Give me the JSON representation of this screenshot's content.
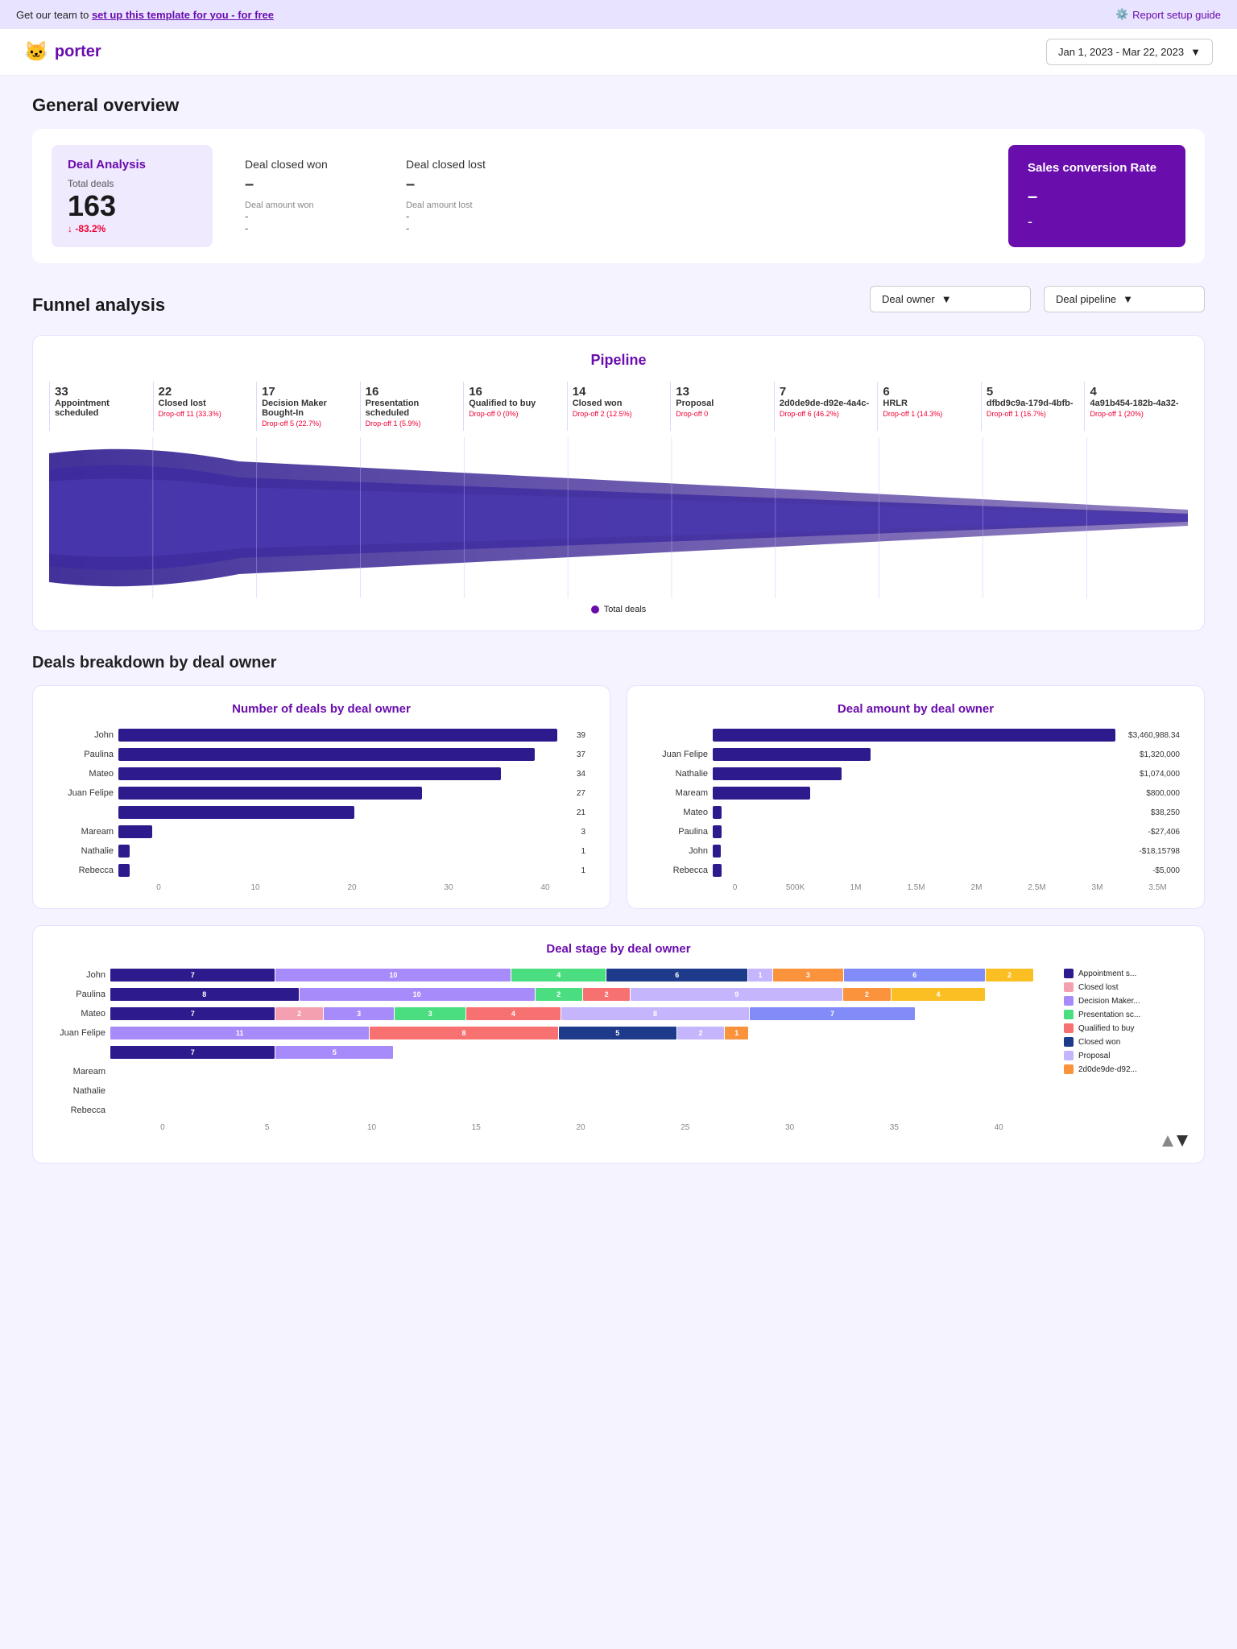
{
  "banner": {
    "text_prefix": "Get our team to ",
    "link_text": "set up this template for you - for free",
    "report_link": "Report setup guide"
  },
  "header": {
    "logo_text": "porter",
    "date_range": "Jan 1, 2023 - Mar 22, 2023"
  },
  "overview": {
    "section_title": "General overview",
    "deal_analysis": {
      "title": "Deal Analysis",
      "total_label": "Total deals",
      "total_value": "163",
      "change": "↓ -83.2%"
    },
    "deal_closed_won": {
      "title": "Deal closed won",
      "value": "–",
      "sub_label": "Deal amount won",
      "sub_value": "-"
    },
    "deal_closed_lost": {
      "title": "Deal closed lost",
      "value": "–",
      "sub_label": "Deal amount lost",
      "sub_value": "-"
    },
    "sales_conversion": {
      "title": "Sales conversion Rate",
      "value": "–",
      "sub_value": "-"
    }
  },
  "funnel": {
    "section_title": "Funnel analysis",
    "dropdown1": "Deal owner",
    "dropdown2": "Deal pipeline",
    "chart_title": "Pipeline",
    "legend": "Total deals",
    "stages": [
      {
        "num": "33",
        "name": "Appointment scheduled",
        "drop": ""
      },
      {
        "num": "22",
        "name": "Closed lost",
        "drop": "Drop-off 11 (33.3%)"
      },
      {
        "num": "17",
        "name": "Decision Maker Bought-In",
        "drop": "Drop-off 5 (22.7%)"
      },
      {
        "num": "16",
        "name": "Presentation scheduled",
        "drop": "Drop-off 1 (5.9%)"
      },
      {
        "num": "16",
        "name": "Qualified to buy",
        "drop": "Drop-off 0 (0%)"
      },
      {
        "num": "14",
        "name": "Closed won",
        "drop": "Drop-off 2 (12.5%)"
      },
      {
        "num": "13",
        "name": "Proposal",
        "drop": "Drop-off 0"
      },
      {
        "num": "7",
        "name": "2d0de9de-d92e-4a4c-",
        "drop": "Drop-off 6 (46.2%)"
      },
      {
        "num": "6",
        "name": "HRLR",
        "drop": "Drop-off 1 (14.3%)"
      },
      {
        "num": "5",
        "name": "dfbd9c9a-179d-4bfb-",
        "drop": "Drop-off 1 (16.7%)"
      },
      {
        "num": "4",
        "name": "4a91b454-182b-4a32-",
        "drop": "Drop-off 1 (20%)"
      }
    ]
  },
  "breakdown": {
    "section_title": "Deals breakdown by deal owner",
    "num_deals_title": "Number of deals by deal owner",
    "deal_amount_title": "Deal amount by deal owner",
    "deal_stage_title": "Deal stage by deal owner",
    "num_deals_bars": [
      {
        "label": "John",
        "value": 39,
        "max": 40
      },
      {
        "label": "Paulina",
        "value": 37,
        "max": 40
      },
      {
        "label": "Mateo",
        "value": 34,
        "max": 40
      },
      {
        "label": "Juan Felipe",
        "value": 27,
        "max": 40
      },
      {
        "label": "",
        "value": 21,
        "max": 40
      },
      {
        "label": "Maream",
        "value": 3,
        "max": 40
      },
      {
        "label": "Nathalie",
        "value": 1,
        "max": 40
      },
      {
        "label": "Rebecca",
        "value": 1,
        "max": 40
      }
    ],
    "num_deals_axis": [
      "0",
      "10",
      "20",
      "30",
      "40"
    ],
    "deal_amount_bars": [
      {
        "label": "",
        "value": 3460988,
        "display": "$3,460,988.34",
        "max": 3500000
      },
      {
        "label": "Juan Felipe",
        "value": 1320000,
        "display": "$1,320,000",
        "max": 3500000
      },
      {
        "label": "Nathalie",
        "value": 1074000,
        "display": "$1,074,000",
        "max": 3500000
      },
      {
        "label": "Maream",
        "value": 800000,
        "display": "$800,000",
        "max": 3500000
      },
      {
        "label": "Mateo",
        "value": 38250,
        "display": "$38,250",
        "max": 3500000
      },
      {
        "label": "Paulina",
        "value": 27406,
        "display": "-$27,406",
        "max": 3500000
      },
      {
        "label": "John",
        "value": 18158,
        "display": "-$18,15798",
        "max": 3500000
      },
      {
        "label": "Rebecca",
        "value": 5000,
        "display": "-$5,000",
        "max": 3500000
      }
    ],
    "deal_amount_axis": [
      "0",
      "500K",
      "1M",
      "1.5M",
      "2M",
      "2.5M",
      "3M",
      "3.5M"
    ],
    "deal_stage_rows": [
      {
        "label": "John",
        "segs": [
          7,
          0,
          10,
          4,
          0,
          6,
          1,
          3,
          6,
          2
        ]
      },
      {
        "label": "Paulina",
        "segs": [
          8,
          0,
          10,
          2,
          2,
          0,
          9,
          2,
          0,
          4
        ]
      },
      {
        "label": "Mateo",
        "segs": [
          7,
          2,
          3,
          3,
          4,
          0,
          8,
          0,
          7,
          0
        ]
      },
      {
        "label": "Juan Felipe",
        "segs": [
          0,
          0,
          11,
          0,
          8,
          5,
          2,
          1,
          0,
          0
        ]
      },
      {
        "label": "",
        "segs": [
          7,
          0,
          5,
          0,
          0,
          0,
          0,
          0,
          0,
          0
        ]
      },
      {
        "label": "Maream",
        "segs": [
          0,
          0,
          0,
          0,
          0,
          0,
          0,
          0,
          0,
          0
        ]
      },
      {
        "label": "Nathalie",
        "segs": [
          0,
          0,
          0,
          0,
          0,
          0,
          0,
          0,
          0,
          0
        ]
      },
      {
        "label": "Rebecca",
        "segs": [
          0,
          0,
          0,
          0,
          0,
          0,
          0,
          0,
          0,
          0
        ]
      }
    ],
    "deal_stage_legend": [
      {
        "label": "Appointment s...",
        "color": "#2d1b8e"
      },
      {
        "label": "Closed lost",
        "color": "#f4a0b0"
      },
      {
        "label": "Decision Maker...",
        "color": "#a78bfa"
      },
      {
        "label": "Presentation sc...",
        "color": "#4ade80"
      },
      {
        "label": "Qualified to buy",
        "color": "#f87171"
      },
      {
        "label": "Closed won",
        "color": "#1e3a8a"
      },
      {
        "label": "Proposal",
        "color": "#c4b5fd"
      },
      {
        "label": "2d0de9de-d92...",
        "color": "#fb923c"
      }
    ],
    "stage_colors": [
      "#2d1b8e",
      "#f4a0b0",
      "#a78bfa",
      "#4ade80",
      "#f87171",
      "#1e3a8a",
      "#c4b5fd",
      "#fb923c",
      "#818cf8",
      "#fbbf24"
    ]
  }
}
